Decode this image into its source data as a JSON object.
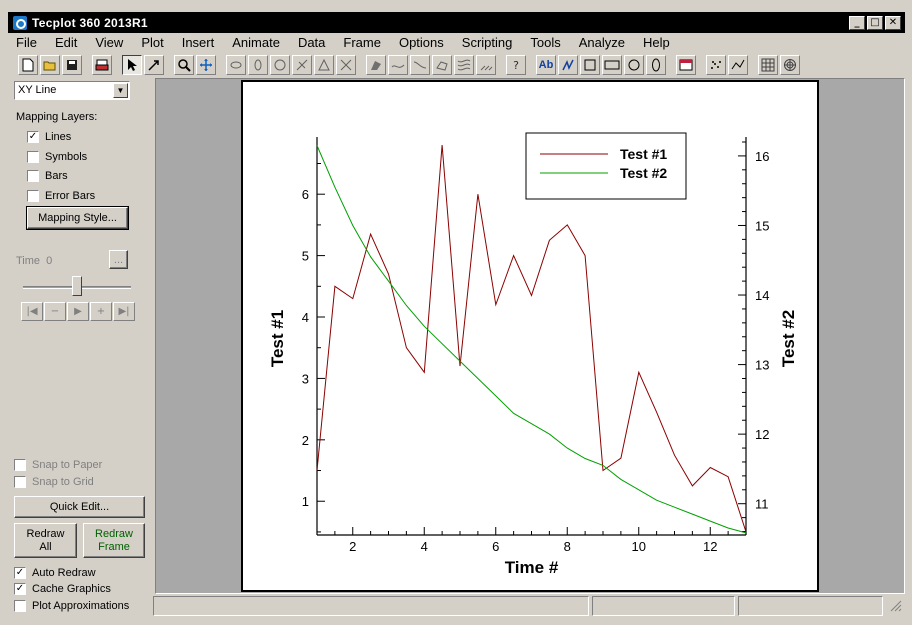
{
  "app": {
    "title": "Tecplot 360 2013R1"
  },
  "window_buttons": [
    "_",
    "□",
    "✕"
  ],
  "menu": [
    "File",
    "Edit",
    "View",
    "Plot",
    "Insert",
    "Animate",
    "Data",
    "Frame",
    "Options",
    "Scripting",
    "Tools",
    "Analyze",
    "Help"
  ],
  "toolbar": {
    "text_tool": "Ab",
    "contour_help": "?"
  },
  "sidebar": {
    "plot_type": "XY Line",
    "mapping_layers_label": "Mapping Layers:",
    "layers": [
      {
        "label": "Lines",
        "checked": "✓"
      },
      {
        "label": "Symbols",
        "checked": ""
      },
      {
        "label": "Bars",
        "checked": ""
      },
      {
        "label": "Error Bars",
        "checked": ""
      }
    ],
    "mapping_style_button": "Mapping Style...",
    "time_label": "Time",
    "time_value": "0",
    "time_more_button": "...",
    "playback": [
      "|◀",
      "−",
      "▶",
      "+",
      "▶|"
    ],
    "snap_to_paper": "Snap to Paper",
    "snap_to_grid": "Snap to Grid",
    "quick_edit_button": "Quick Edit...",
    "redraw_all_line1": "Redraw",
    "redraw_all_line2": "All",
    "redraw_frame_line1": "Redraw",
    "redraw_frame_line2": "Frame",
    "auto_redraw": {
      "label": "Auto Redraw",
      "checked": "✓"
    },
    "cache_graphics": {
      "label": "Cache Graphics",
      "checked": "✓"
    },
    "plot_approximations": {
      "label": "Plot Approximations",
      "checked": ""
    }
  },
  "chart_data": {
    "type": "line",
    "xlabel": "Time #",
    "ylabel": "Test #1",
    "y2label": "Test #2",
    "xlim": [
      1,
      13
    ],
    "ylim": [
      0.45,
      6.85
    ],
    "y2lim": [
      10.55,
      16.2
    ],
    "xticks": [
      2,
      4,
      6,
      8,
      10,
      12
    ],
    "yticks": [
      1,
      2,
      3,
      4,
      5,
      6
    ],
    "y2ticks": [
      11,
      12,
      13,
      14,
      15,
      16
    ],
    "legend_position": "top-right",
    "grid": false,
    "series": [
      {
        "name": "Test #1",
        "axis": "left",
        "color": "#8b0000",
        "x": [
          1,
          1.5,
          2,
          2.5,
          3,
          3.5,
          4,
          4.5,
          5,
          5.5,
          6,
          6.5,
          7,
          7.5,
          8,
          8.5,
          9,
          9.5,
          10,
          10.5,
          11,
          11.5,
          12,
          12.5,
          13
        ],
        "y": [
          1.5,
          4.5,
          4.3,
          5.35,
          4.7,
          3.5,
          3.1,
          6.8,
          3.2,
          6.0,
          4.2,
          5.0,
          4.35,
          5.25,
          5.5,
          5.0,
          1.5,
          1.7,
          3.1,
          2.45,
          1.75,
          1.25,
          1.55,
          1.4,
          0.5
        ]
      },
      {
        "name": "Test #2",
        "axis": "right",
        "color": "#00a000",
        "x": [
          1,
          1.5,
          2,
          2.5,
          3,
          3.5,
          4,
          4.5,
          5,
          5.5,
          6,
          6.5,
          7,
          7.5,
          8,
          8.5,
          9,
          9.5,
          10,
          10.5,
          11,
          11.5,
          12,
          12.5,
          13
        ],
        "y": [
          16.15,
          15.55,
          15.0,
          14.55,
          14.2,
          13.85,
          13.55,
          13.3,
          13.05,
          12.8,
          12.55,
          12.3,
          12.15,
          12.0,
          11.8,
          11.65,
          11.55,
          11.35,
          11.2,
          11.05,
          10.95,
          10.85,
          10.75,
          10.65,
          10.58
        ]
      }
    ]
  }
}
